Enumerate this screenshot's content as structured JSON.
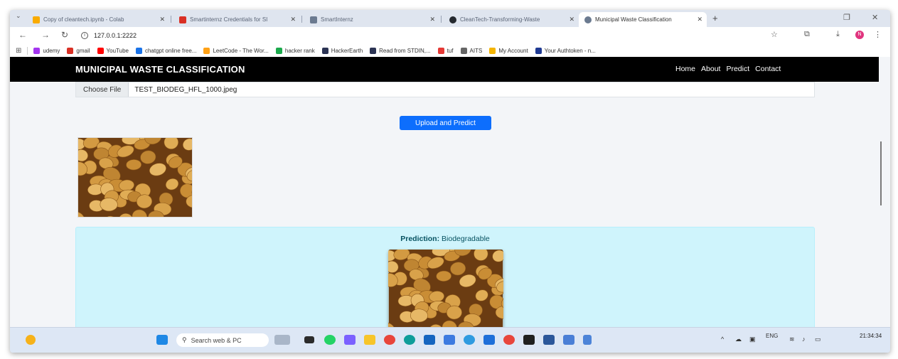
{
  "browser": {
    "tabs": [
      {
        "title": "Copy of cleantech.ipynb - Colab",
        "color": "#f9ab00"
      },
      {
        "title": "Smartinternz Credentials for SI",
        "color": "#d93025"
      },
      {
        "title": "SmartInternz",
        "color": "#6b7a90"
      },
      {
        "title": "CleanTech-Transforming-Waste",
        "color": "#24292f"
      },
      {
        "title": "Municipal Waste Classification",
        "color": "#6b7a90"
      }
    ],
    "url": "127.0.0.1:2222",
    "bookmarks": [
      {
        "label": "udemy",
        "color": "#a435f0"
      },
      {
        "label": "gmail",
        "color": "#d93025"
      },
      {
        "label": "YouTube",
        "color": "#ff0000"
      },
      {
        "label": "chatgpt online free...",
        "color": "#1a73e8"
      },
      {
        "label": "LeetCode - The Wor...",
        "color": "#ffa116"
      },
      {
        "label": "hacker rank",
        "color": "#1ba94c"
      },
      {
        "label": "HackerEarth",
        "color": "#2c3454"
      },
      {
        "label": "Read from STDIN,...",
        "color": "#2c3454"
      },
      {
        "label": "tuf",
        "color": "#e53935"
      },
      {
        "label": "AITS",
        "color": "#666666"
      },
      {
        "label": "My Account",
        "color": "#f4b400"
      },
      {
        "label": "Your Authtoken - n...",
        "color": "#1f3a93"
      }
    ],
    "profile_initial": "N"
  },
  "page": {
    "brand": "MUNICIPAL WASTE CLASSIFICATION",
    "nav": [
      "Home",
      "About",
      "Predict",
      "Contact"
    ],
    "file_button": "Choose File",
    "file_name": "TEST_BIODEG_HFL_1000.jpeg",
    "upload_button": "Upload and Predict",
    "prediction_label": "Prediction:",
    "prediction_value": "Biodegradable"
  },
  "taskbar": {
    "search_placeholder": "Search web & PC",
    "lang": "ENG",
    "time": "21:34:34",
    "accent": "#0d6efd"
  }
}
